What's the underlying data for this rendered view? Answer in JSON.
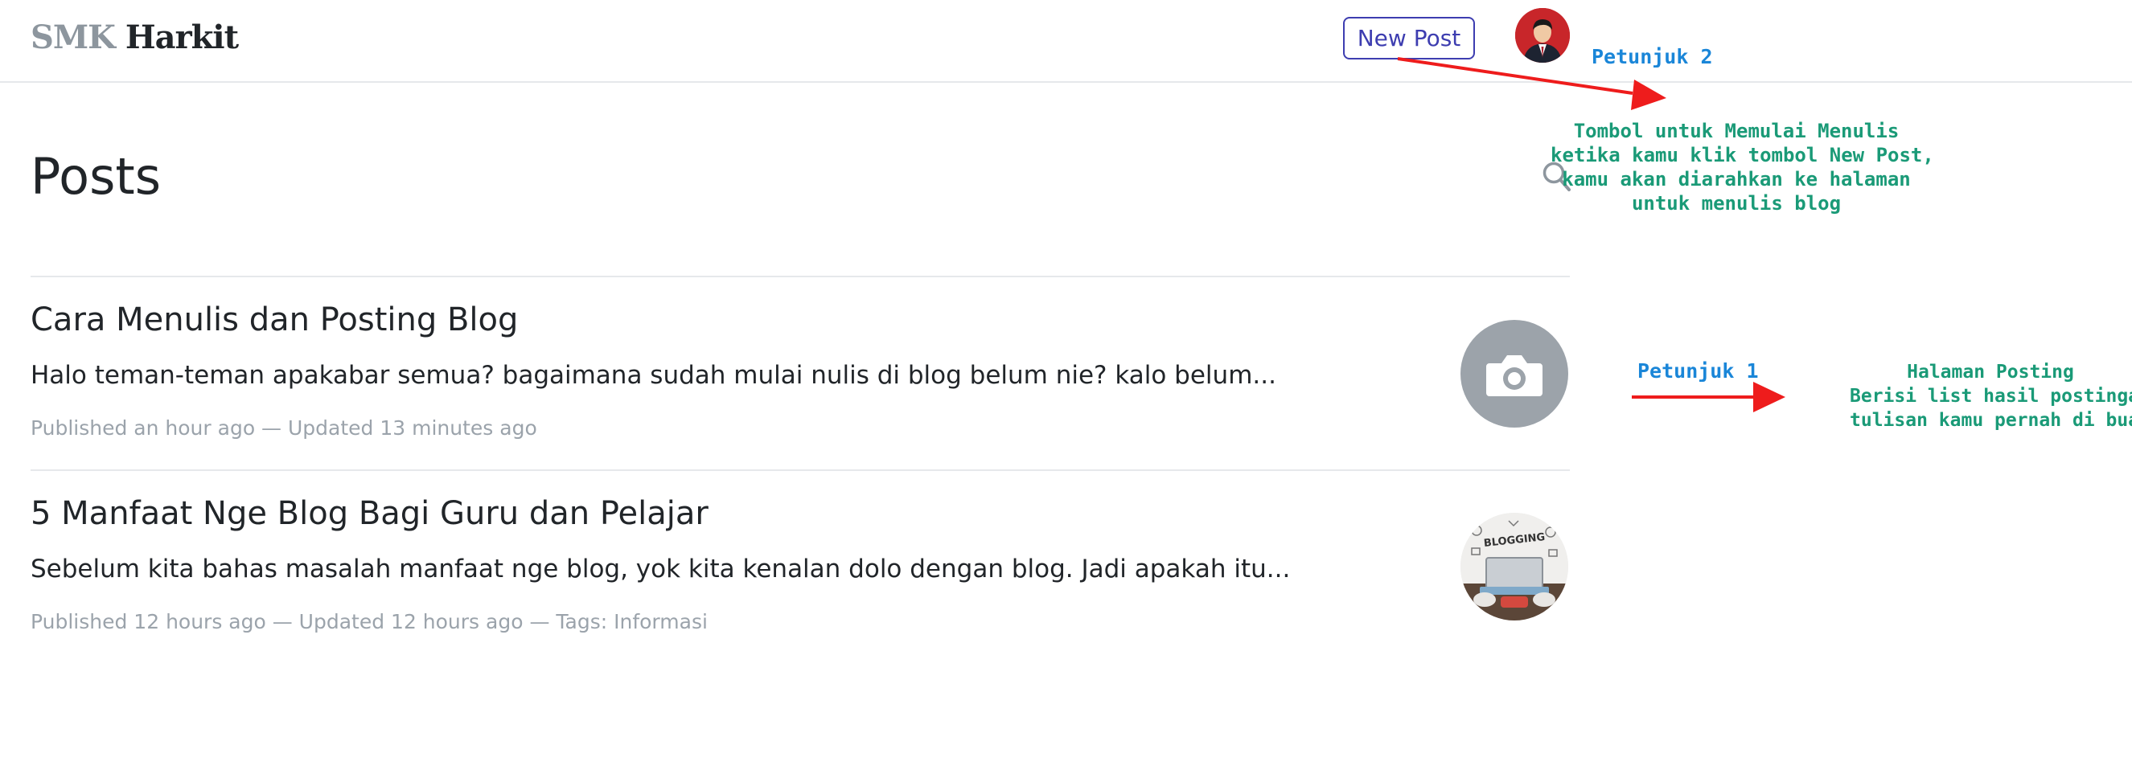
{
  "header": {
    "brand_part1": "SMK",
    "brand_part2": "Harkit",
    "new_post_label": "New Post",
    "avatar_icon": "user-photo"
  },
  "main": {
    "title": "Posts",
    "search_icon": "search-icon"
  },
  "posts": [
    {
      "title": "Cara Menulis dan Posting Blog",
      "excerpt": "Halo teman-teman apakabar semua? bagaimana sudah mulai nulis di blog belum nie? kalo belum...",
      "meta": "Published an hour ago — Updated 13 minutes ago",
      "thumbnail": "camera-placeholder"
    },
    {
      "title": "5 Manfaat Nge Blog Bagi Guru dan Pelajar",
      "excerpt": "Sebelum kita bahas masalah manfaat nge blog, yok kita kenalan dolo dengan blog. Jadi apakah itu...",
      "meta": "Published 12 hours ago — Updated 12 hours ago — Tags: Informasi",
      "thumbnail": "blogging-illustration",
      "thumbnail_text": "BLOGGING"
    }
  ],
  "annotations": {
    "hint2_label": "Petunjuk 2",
    "hint2_lines": [
      "Tombol untuk Memulai Menulis",
      "ketika kamu klik tombol New Post,",
      "kamu akan diarahkan ke halaman",
      "untuk menulis blog"
    ],
    "hint1_label": "Petunjuk 1",
    "hint1_lines": [
      "Halaman Posting",
      "Berisi list hasil postingan",
      "tulisan kamu pernah di buat"
    ]
  },
  "colors": {
    "accent": "#3d3db0",
    "annotation_label": "#1a86d8",
    "annotation_text": "#1a9a77",
    "arrow": "#ee1c1c",
    "meta_text": "#9ba3ab"
  }
}
